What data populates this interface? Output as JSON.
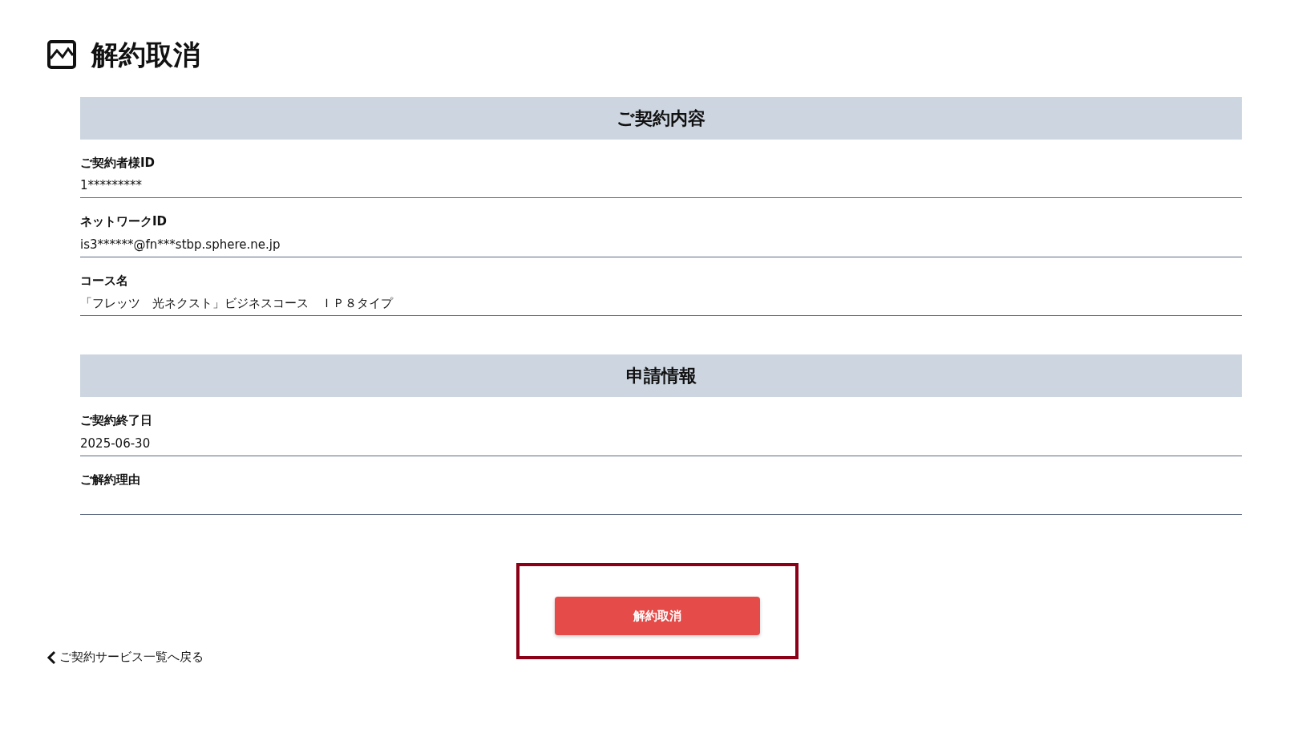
{
  "page_title": "解約取消",
  "sections": [
    {
      "title": "ご契約内容",
      "fields": [
        {
          "label": "ご契約者様ID",
          "value": "1*********"
        },
        {
          "label": "ネットワークID",
          "value": "is3******@fn***stbp.sphere.ne.jp"
        },
        {
          "label": "コース名",
          "value": "「フレッツ　光ネクスト」ビジネスコース　ＩＰ８タイプ"
        }
      ]
    },
    {
      "title": "申請情報",
      "fields": [
        {
          "label": "ご契約終了日",
          "value": "2025-06-30"
        },
        {
          "label": "ご解約理由"
        }
      ]
    }
  ],
  "action_button": {
    "label": "解約取消",
    "highlighted": true
  },
  "back_link": {
    "label": "ご契約サービス一覧へ戻る"
  }
}
